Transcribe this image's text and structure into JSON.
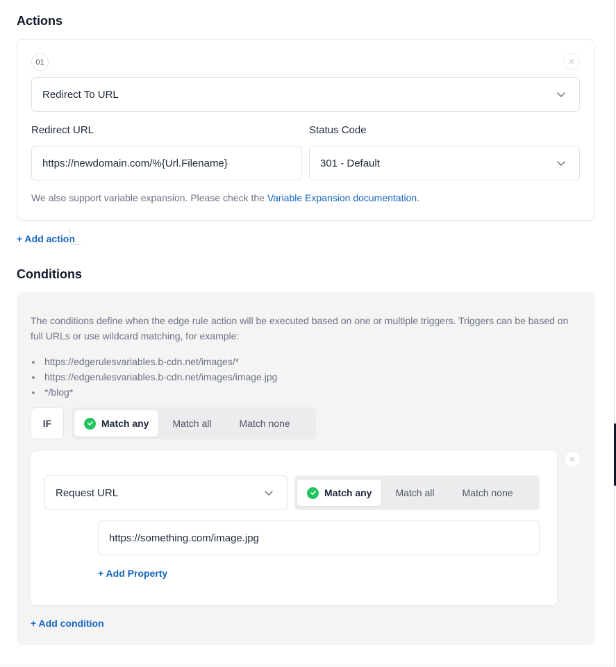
{
  "actions": {
    "title": "Actions",
    "items": [
      {
        "number": "01",
        "close_icon": "close-icon",
        "type_value": "Redirect To URL",
        "redirect_url_label": "Redirect URL",
        "redirect_url_value": "https://newdomain.com/%{Url.Filename}",
        "status_code_label": "Status Code",
        "status_code_value": "301 - Default",
        "helper_text": "We also support variable expansion. Please check the ",
        "helper_link": "Variable Expansion documentation",
        "helper_end": "."
      }
    ],
    "add_action_label": "+ Add action"
  },
  "conditions": {
    "title": "Conditions",
    "description": "The conditions define when the edge rule action will be executed based on one or multiple triggers. Triggers can be based on full URLs or use wildcard matching, for example:",
    "examples": [
      "https://edgerulesvariables.b-cdn.net/images/*",
      "https://edgerulesvariables.b-cdn.net/images/image.jpg",
      "*/blog*"
    ],
    "if_label": "IF",
    "match_options": [
      "Match any",
      "Match all",
      "Match none"
    ],
    "match_selected": "Match any",
    "condition": {
      "type_value": "Request URL",
      "match_options": [
        "Match any",
        "Match all",
        "Match none"
      ],
      "match_selected": "Match any",
      "property_value": "https://something.com/image.jpg",
      "add_property_label": "+ Add Property"
    },
    "add_condition_label": "+ Add condition"
  },
  "colors": {
    "link": "#1565c0",
    "check": "#22c55e"
  }
}
